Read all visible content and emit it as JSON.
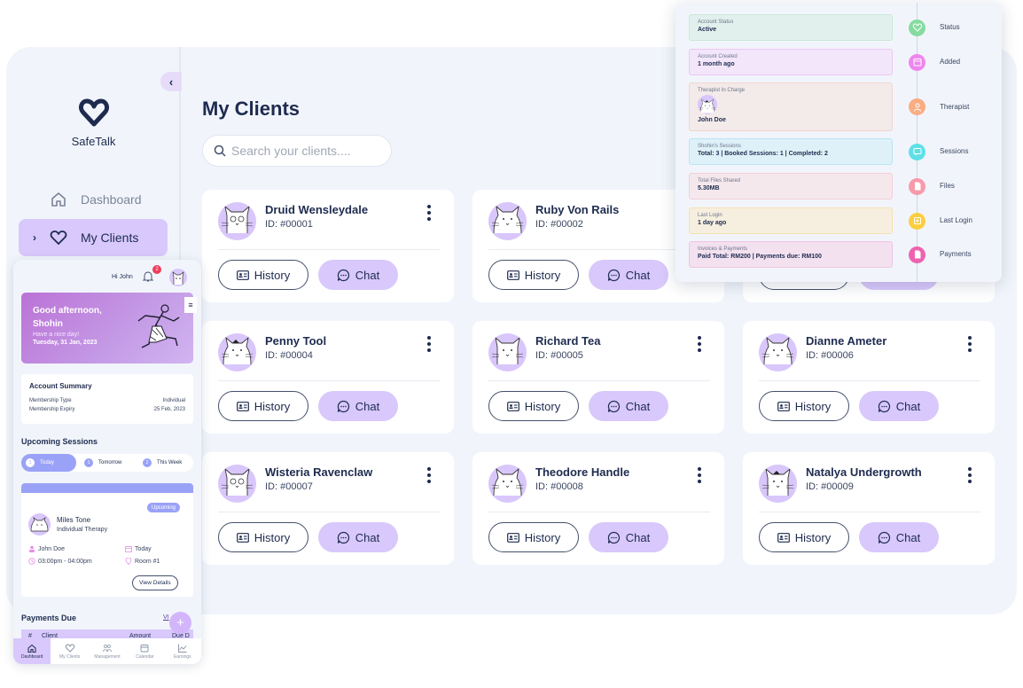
{
  "app": {
    "brand": "SafeTalk",
    "page_title": "My Clients"
  },
  "sidebar": {
    "items": [
      {
        "label": "Dashboard",
        "icon": "home-icon",
        "active": false
      },
      {
        "label": "My Clients",
        "icon": "heart-icon",
        "active": true
      }
    ]
  },
  "search": {
    "placeholder": "Search your clients....",
    "value": ""
  },
  "card_actions": {
    "history_label": "History",
    "chat_label": "Chat"
  },
  "clients": [
    {
      "name": "Druid Wensleydale",
      "id": "ID: #00001"
    },
    {
      "name": "Ruby Von Rails",
      "id": "ID: #00002"
    },
    {
      "name": "",
      "id": ""
    },
    {
      "name": "Penny Tool",
      "id": "ID: #00004"
    },
    {
      "name": "Richard Tea",
      "id": "ID: #00005"
    },
    {
      "name": "Dianne Ameter",
      "id": "ID: #00006"
    },
    {
      "name": "Wisteria Ravenclaw",
      "id": "ID: #00007"
    },
    {
      "name": "Theodore Handle",
      "id": "ID: #00008"
    },
    {
      "name": "Natalya Undergrowth",
      "id": "ID: #00009"
    }
  ],
  "details": {
    "items": [
      {
        "label": "Account Status",
        "value": "Active",
        "tag": "Status",
        "icon": "heart-icon",
        "bg": "#e2f0ed",
        "border": "#c8e8d6",
        "dot": "#86dba0"
      },
      {
        "label": "Account Created",
        "value": "1 month ago",
        "tag": "Added",
        "icon": "calendar-icon",
        "bg": "#f3e6fb",
        "border": "#ecc6f5",
        "dot": "#ef86ee"
      },
      {
        "label": "Therapist In Charge",
        "value": "John Doe",
        "tag": "Therapist",
        "icon": "user-icon",
        "bg": "#f3eaea",
        "border": "#f2d5cc",
        "dot": "#f9ad82"
      },
      {
        "label": "Shohin's Sessions",
        "value": "Total: 3  |  Booked Sessions: 1  |  Completed: 2",
        "tag": "Sessions",
        "icon": "chat-icon",
        "bg": "#dff1f8",
        "border": "#b8e4f2",
        "dot": "#5fdfe6"
      },
      {
        "label": "Total Files Shared",
        "value": "5.30MB",
        "tag": "Files",
        "icon": "file-icon",
        "bg": "#f5e8ec",
        "border": "#f5ccd8",
        "dot": "#f79aaa"
      },
      {
        "label": "Last Login",
        "value": "1 day ago",
        "tag": "Last Login",
        "icon": "login-icon",
        "bg": "#f6efe0",
        "border": "#f6e0b0",
        "dot": "#fbce3f"
      },
      {
        "label": "Invoices & Payments",
        "value": "Paid Total: RM200  |  Payments due: RM100",
        "tag": "Payments",
        "icon": "document-icon",
        "bg": "#f3e1f0",
        "border": "#efc3e4",
        "dot": "#ee62b0"
      }
    ]
  },
  "mobile": {
    "greeting_user": "Hi John",
    "notification_count": "2",
    "hero": {
      "greeting": "Good afternoon, Shohin",
      "subtitle": "Have a nice day!",
      "date": "Tuesday, 31 Jan, 2023"
    },
    "summary": {
      "title": "Account Summary",
      "rows": [
        {
          "label": "Membership Type",
          "value": "Individual"
        },
        {
          "label": "Membership Expiry",
          "value": "25 Feb, 2023"
        }
      ]
    },
    "upcoming": {
      "title": "Upcoming Sessions",
      "tabs": [
        {
          "count": "1",
          "label": "Today",
          "active": true
        },
        {
          "count": "1",
          "label": "Tomorrow",
          "active": false
        },
        {
          "count": "2",
          "label": "This Week",
          "active": false
        }
      ],
      "session": {
        "status": "Upcoming",
        "name": "Miles Tone",
        "type": "Individual Therapy",
        "therapist": "John Doe",
        "day": "Today",
        "time": "03:00pm - 04:00pm",
        "room": "Room #1",
        "view_label": "View Details"
      }
    },
    "payments": {
      "title": "Payments Due",
      "view_label": "VI",
      "columns": [
        "#",
        "Client",
        "Amount",
        "Due D"
      ]
    },
    "bottom_nav": [
      {
        "label": "Dashboard",
        "icon": "home-icon",
        "active": true
      },
      {
        "label": "My Clients",
        "icon": "heart-icon",
        "active": false
      },
      {
        "label": "Management",
        "icon": "users-icon",
        "active": false
      },
      {
        "label": "Calendar",
        "icon": "calendar-icon",
        "active": false
      },
      {
        "label": "Earnings",
        "icon": "chart-icon",
        "active": false
      }
    ]
  },
  "colors": {
    "primary_dark": "#1e2b4f",
    "accent_lavender": "#d8c8fb",
    "background": "#f1f5fb",
    "session_blue": "#9aa2f7"
  }
}
